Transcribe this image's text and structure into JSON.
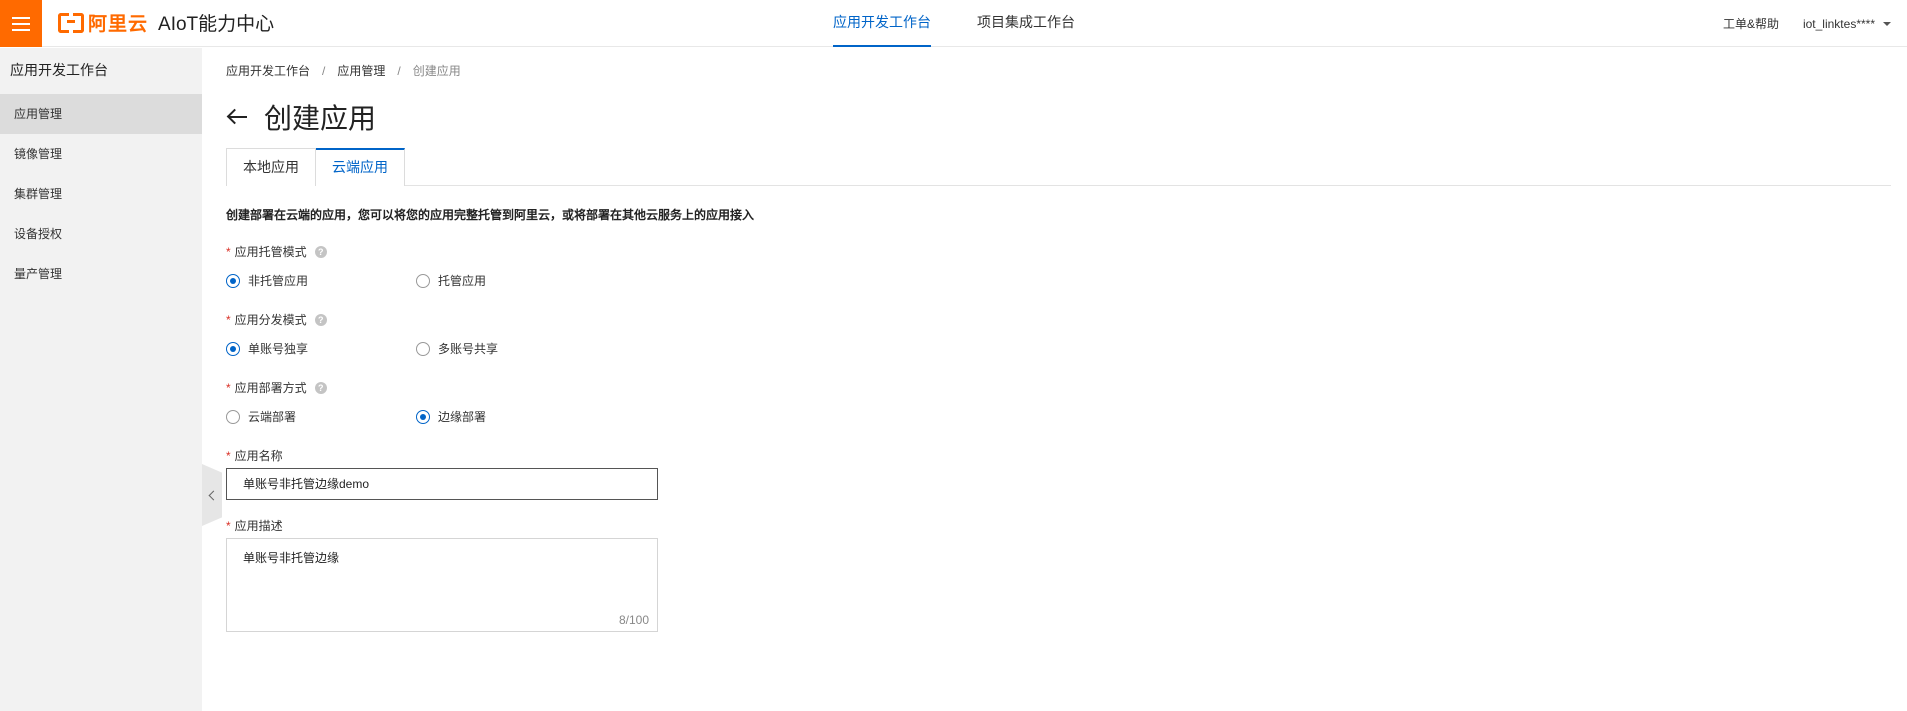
{
  "header": {
    "brand": "阿里云",
    "product": "AIoT能力中心",
    "nav": [
      {
        "label": "应用开发工作台",
        "active": true
      },
      {
        "label": "项目集成工作台",
        "active": false
      }
    ],
    "help": "工单&帮助",
    "user": "iot_linktes****"
  },
  "sidebar": {
    "title": "应用开发工作台",
    "items": [
      {
        "label": "应用管理",
        "active": true
      },
      {
        "label": "镜像管理",
        "active": false
      },
      {
        "label": "集群管理",
        "active": false
      },
      {
        "label": "设备授权",
        "active": false
      },
      {
        "label": "量产管理",
        "active": false
      }
    ]
  },
  "breadcrumb": [
    "应用开发工作台",
    "应用管理",
    "创建应用"
  ],
  "breadcrumb_sep": "/",
  "page": {
    "title": "创建应用",
    "tabs": [
      {
        "label": "本地应用",
        "active": false
      },
      {
        "label": "云端应用",
        "active": true
      }
    ],
    "intro": "创建部署在云端的应用，您可以将您的应用完整托管到阿里云，或将部署在其他云服务上的应用接入"
  },
  "form": {
    "required_mark": "*",
    "help_glyph": "?",
    "hosting_mode": {
      "label": "应用托管模式",
      "options": [
        "非托管应用",
        "托管应用"
      ],
      "selected": 0
    },
    "distribution_mode": {
      "label": "应用分发模式",
      "options": [
        "单账号独享",
        "多账号共享"
      ],
      "selected": 0
    },
    "deploy_method": {
      "label": "应用部署方式",
      "options": [
        "云端部署",
        "边缘部署"
      ],
      "selected": 1
    },
    "app_name": {
      "label": "应用名称",
      "value": "单账号非托管边缘demo"
    },
    "app_desc": {
      "label": "应用描述",
      "value": "单账号非托管边缘",
      "counter": "8/100"
    }
  },
  "colors": {
    "accent": "#0064c8",
    "brand": "#ff6a00",
    "required": "#d93026"
  }
}
